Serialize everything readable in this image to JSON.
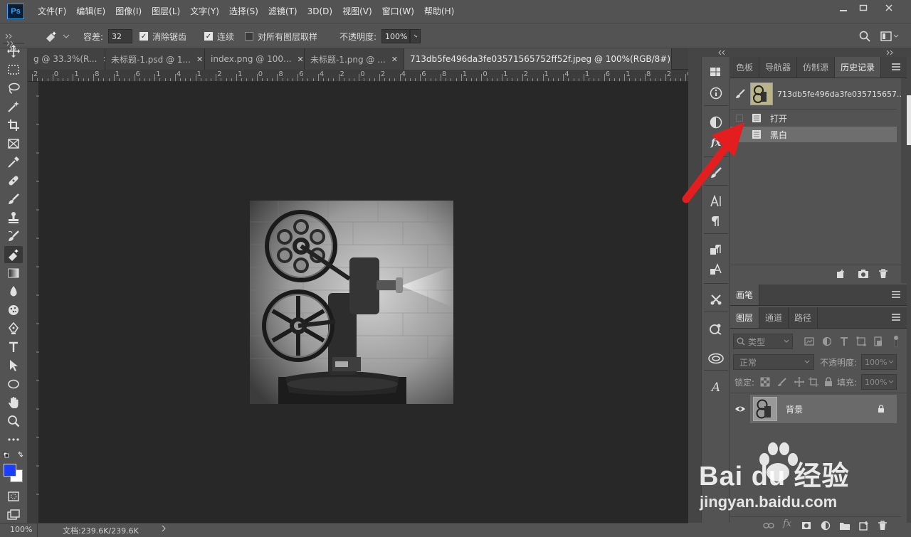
{
  "app": {
    "logo": "Ps"
  },
  "menu": [
    "文件(F)",
    "编辑(E)",
    "图像(I)",
    "图层(L)",
    "文字(Y)",
    "选择(S)",
    "滤镜(T)",
    "3D(D)",
    "视图(V)",
    "窗口(W)",
    "帮助(H)"
  ],
  "options": {
    "tolerance_label": "容差:",
    "tolerance_value": "32",
    "antialias_label": "消除锯齿",
    "contiguous_label": "连续",
    "all_layers_label": "对所有图层取样",
    "opacity_label": "不透明度:",
    "opacity_value": "100%"
  },
  "tabs": [
    "g @ 33.3%(R...",
    "未标题-1.psd @ 1...",
    "index.png @ 100...",
    "未标题-1.png @ ...",
    "713db5fe496da3fe03571565752ff52f.jpeg @ 100%(RGB/8#) *"
  ],
  "ruler": [
    "2",
    "0",
    "1",
    "8",
    "1",
    "6",
    "1",
    "4",
    "1",
    "2",
    "1",
    "0",
    "8",
    "6",
    "4",
    "2",
    "0",
    "2",
    "4",
    "6",
    "8",
    "1",
    "0",
    "1",
    "2",
    "1",
    "4",
    "1",
    "6",
    "1",
    "8",
    "2",
    "0"
  ],
  "status": {
    "zoom": "100%",
    "doc": "文档:239.6K/239.6K"
  },
  "history_panel": {
    "tabs": [
      "色板",
      "导航器",
      "仿制源",
      "历史记录"
    ],
    "snapshot_name": "713db5fe496da3fe035715657...",
    "steps": [
      "打开",
      "黑白"
    ]
  },
  "brush_panel": {
    "tab": "画笔"
  },
  "layers_panel": {
    "tabs": [
      "图层",
      "通道",
      "路径"
    ],
    "filter_placeholder": "类型",
    "blend_mode": "正常",
    "opacity_label": "不透明度:",
    "opacity_value": "100%",
    "lock_label": "锁定:",
    "fill_label": "填充:",
    "fill_value": "100%",
    "layer_name": "背景"
  },
  "watermark": {
    "brand": "Bai du 经验",
    "site": "jingyan.baidu.com"
  }
}
